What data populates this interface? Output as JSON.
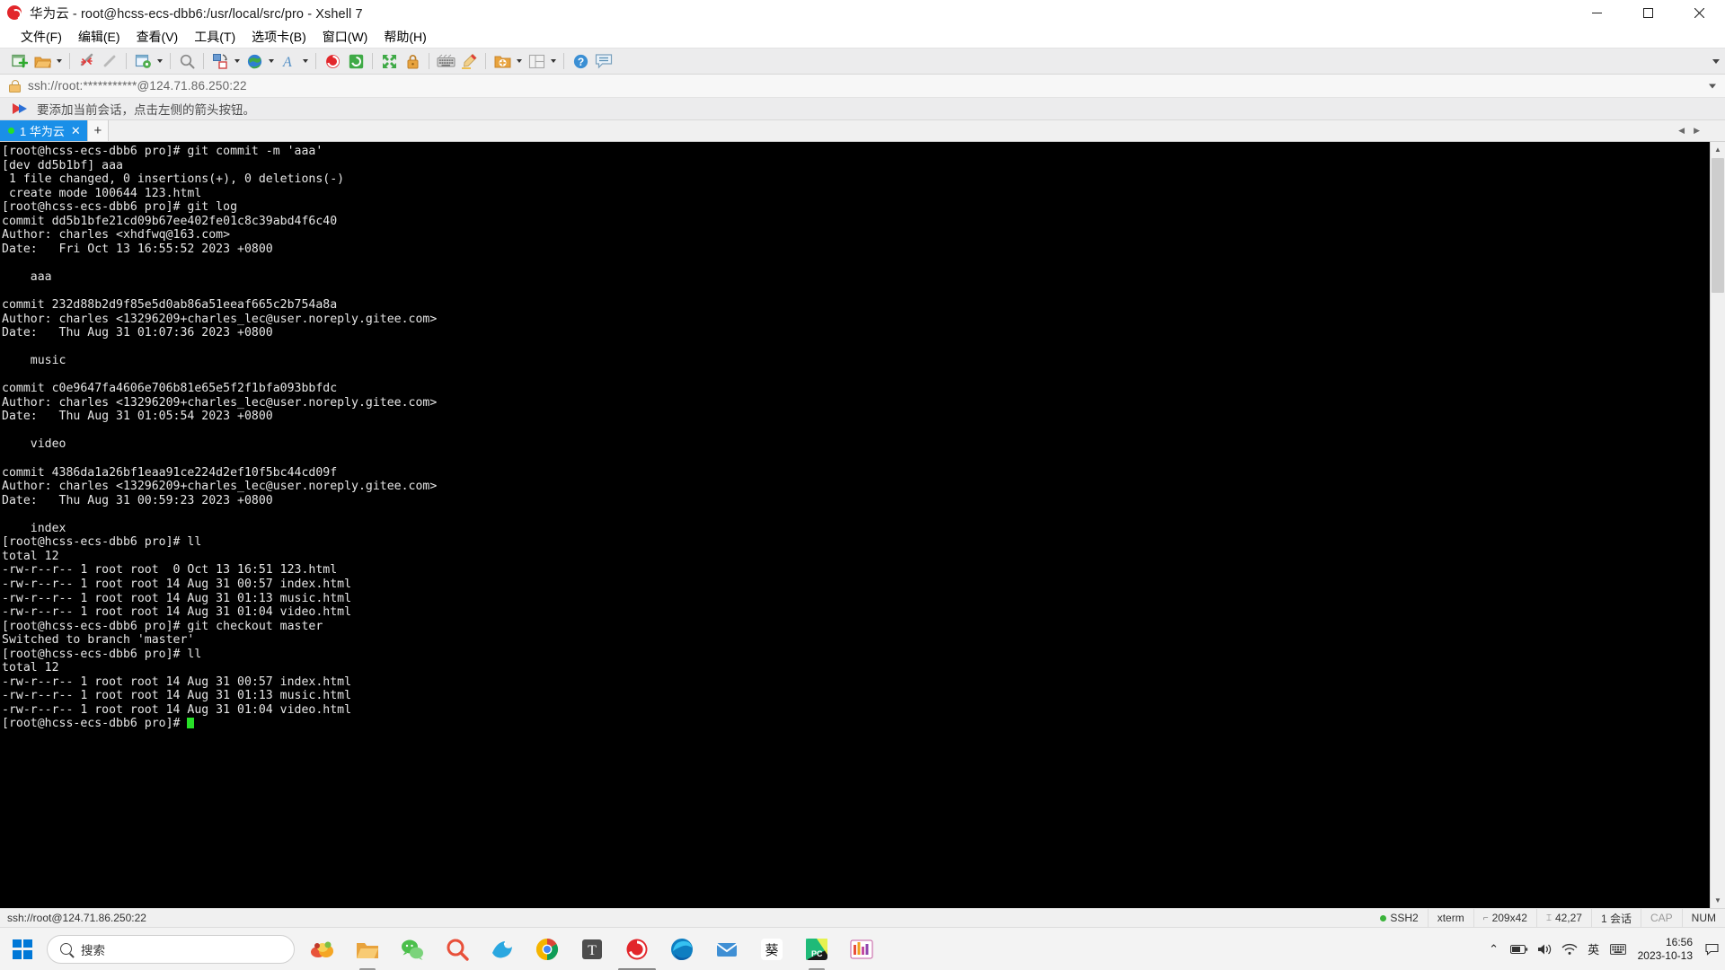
{
  "window": {
    "title": "华为云 - root@hcss-ecs-dbb6:/usr/local/src/pro - Xshell 7",
    "app_icon": "xshell-spiral-icon",
    "minimize_label": "–",
    "maximize_label": "□",
    "close_label": "✕"
  },
  "menubar": {
    "items": [
      {
        "label": "文件(F)",
        "name": "menu-file"
      },
      {
        "label": "编辑(E)",
        "name": "menu-edit"
      },
      {
        "label": "查看(V)",
        "name": "menu-view"
      },
      {
        "label": "工具(T)",
        "name": "menu-tools"
      },
      {
        "label": "选项卡(B)",
        "name": "menu-tabs"
      },
      {
        "label": "窗口(W)",
        "name": "menu-window"
      },
      {
        "label": "帮助(H)",
        "name": "menu-help"
      }
    ]
  },
  "toolbar": {
    "buttons": [
      {
        "name": "new-session-icon",
        "title": "新建会话"
      },
      {
        "name": "open-folder-icon",
        "title": "打开"
      },
      {
        "name": "open-folder-dropdown-icon",
        "title": "打开下拉"
      },
      {
        "name": "disconnect-icon",
        "title": "断开"
      },
      {
        "name": "reconnect-icon",
        "title": "重新连接"
      },
      {
        "name": "properties-icon",
        "title": "属性"
      },
      {
        "name": "properties-dropdown-icon",
        "title": "属性下拉"
      },
      {
        "name": "find-icon",
        "title": "查找"
      },
      {
        "name": "file-transfer-icon",
        "title": "文件传输"
      },
      {
        "name": "file-transfer-dropdown-icon",
        "title": "文件传输下拉"
      },
      {
        "name": "globe-icon",
        "title": "编码"
      },
      {
        "name": "globe-dropdown-icon",
        "title": "编码下拉"
      },
      {
        "name": "font-icon",
        "title": "字体"
      },
      {
        "name": "font-dropdown-icon",
        "title": "字体下拉"
      },
      {
        "name": "xshell-icon",
        "title": "Xshell"
      },
      {
        "name": "xftp-icon",
        "title": "Xftp"
      },
      {
        "name": "fullscreen-icon",
        "title": "全屏"
      },
      {
        "name": "lock-icon",
        "title": "锁定"
      },
      {
        "name": "keyboard-icon",
        "title": "按键输入"
      },
      {
        "name": "compose-icon",
        "title": "撰写栏"
      },
      {
        "name": "add-folder-icon",
        "title": "新建文件夹"
      },
      {
        "name": "add-folder-dropdown-icon",
        "title": "新建文件夹下拉"
      },
      {
        "name": "layout-icon",
        "title": "排列"
      },
      {
        "name": "layout-dropdown-icon",
        "title": "排列下拉"
      },
      {
        "name": "help-icon",
        "title": "帮助"
      },
      {
        "name": "feedback-icon",
        "title": "反馈"
      }
    ]
  },
  "address_bar": {
    "value": "ssh://root:***********@124.71.86.250:22",
    "icon": "lock-icon"
  },
  "notice_bar": {
    "icon": "arrow-hint-icon",
    "text": "要添加当前会话，点击左侧的箭头按钮。"
  },
  "tabs": {
    "items": [
      {
        "label": "1 华为云",
        "status": "connected",
        "close_label": "✕"
      }
    ],
    "new_tab_label": "+",
    "scroll_left_label": "◀",
    "scroll_right_label": "▶"
  },
  "terminal": {
    "lines": [
      "[root@hcss-ecs-dbb6 pro]# git commit -m 'aaa'",
      "[dev dd5b1bf] aaa",
      " 1 file changed, 0 insertions(+), 0 deletions(-)",
      " create mode 100644 123.html",
      "[root@hcss-ecs-dbb6 pro]# git log",
      "commit dd5b1bfe21cd09b67ee402fe01c8c39abd4f6c40",
      "Author: charles <xhdfwq@163.com>",
      "Date:   Fri Oct 13 16:55:52 2023 +0800",
      "",
      "    aaa",
      "",
      "commit 232d88b2d9f85e5d0ab86a51eeaf665c2b754a8a",
      "Author: charles <13296209+charles_lec@user.noreply.gitee.com>",
      "Date:   Thu Aug 31 01:07:36 2023 +0800",
      "",
      "    music",
      "",
      "commit c0e9647fa4606e706b81e65e5f2f1bfa093bbfdc",
      "Author: charles <13296209+charles_lec@user.noreply.gitee.com>",
      "Date:   Thu Aug 31 01:05:54 2023 +0800",
      "",
      "    video",
      "",
      "commit 4386da1a26bf1eaa91ce224d2ef10f5bc44cd09f",
      "Author: charles <13296209+charles_lec@user.noreply.gitee.com>",
      "Date:   Thu Aug 31 00:59:23 2023 +0800",
      "",
      "    index",
      "[root@hcss-ecs-dbb6 pro]# ll",
      "total 12",
      "-rw-r--r-- 1 root root  0 Oct 13 16:51 123.html",
      "-rw-r--r-- 1 root root 14 Aug 31 00:57 index.html",
      "-rw-r--r-- 1 root root 14 Aug 31 01:13 music.html",
      "-rw-r--r-- 1 root root 14 Aug 31 01:04 video.html",
      "[root@hcss-ecs-dbb6 pro]# git checkout master",
      "Switched to branch 'master'",
      "[root@hcss-ecs-dbb6 pro]# ll",
      "total 12",
      "-rw-r--r-- 1 root root 14 Aug 31 00:57 index.html",
      "-rw-r--r-- 1 root root 14 Aug 31 01:13 music.html",
      "-rw-r--r-- 1 root root 14 Aug 31 01:04 video.html"
    ],
    "prompt": "[root@hcss-ecs-dbb6 pro]# ",
    "cursor": "block"
  },
  "statusbar": {
    "connection": "ssh://root@124.71.86.250:22",
    "protocol": "SSH2",
    "terminal_type": "xterm",
    "size": "209x42",
    "cursor_pos": "42,27",
    "sessions": "1 会话",
    "caps": "CAP",
    "num": "NUM",
    "size_icon": "resize-icon",
    "cursor_icon": "cursor-icon",
    "session_icon": "session-icon"
  },
  "taskbar": {
    "start_label": "start-button",
    "search_placeholder": "搜索",
    "search_icon": "search-icon",
    "apps": [
      {
        "name": "taskbar-app-fruit",
        "glyph": "fruit-icon"
      },
      {
        "name": "taskbar-app-file-explorer",
        "glyph": "folder-icon"
      },
      {
        "name": "taskbar-app-wechat",
        "glyph": "wechat-icon"
      },
      {
        "name": "taskbar-app-search",
        "glyph": "magnifier-icon"
      },
      {
        "name": "taskbar-app-bird",
        "glyph": "bird-icon"
      },
      {
        "name": "taskbar-app-chrome",
        "glyph": "chrome-icon"
      },
      {
        "name": "taskbar-app-typora",
        "glyph": "typora-icon"
      },
      {
        "name": "taskbar-app-xshell",
        "glyph": "xshell-icon"
      },
      {
        "name": "taskbar-app-edge",
        "glyph": "edge-icon"
      },
      {
        "name": "taskbar-app-mail",
        "glyph": "mail-icon"
      },
      {
        "name": "taskbar-app-kui",
        "glyph": "kui-icon"
      },
      {
        "name": "taskbar-app-pycharm",
        "glyph": "pycharm-icon"
      },
      {
        "name": "taskbar-app-navicat",
        "glyph": "navicat-icon"
      }
    ],
    "tray": {
      "overflow": "⌃",
      "battery": "battery-icon",
      "volume": "volume-icon",
      "network": "network-icon",
      "ime": "英",
      "keyboard": "keyboard-icon"
    },
    "clock": {
      "time": "16:56",
      "date": "2023-10-13"
    },
    "notification_icon": "notification-icon"
  },
  "colors": {
    "tab_active": "#1a8fe8",
    "terminal_bg": "#000000",
    "terminal_fg": "#e6e6e6",
    "cursor": "#28e028",
    "accent": "#0078d7",
    "status_ok": "#3bb33b"
  }
}
